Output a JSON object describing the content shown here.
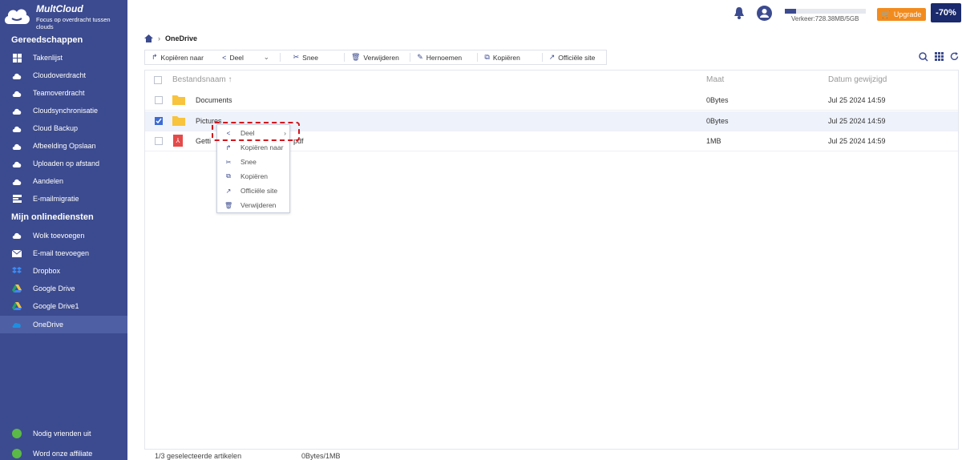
{
  "app": {
    "name": "MultCloud",
    "tagline": "Focus op overdracht tussen clouds"
  },
  "sidebar": {
    "section_tools": "Gereedschappen",
    "tools": [
      {
        "label": "Takenlijst",
        "icon": "grid-icon"
      },
      {
        "label": "Cloudoverdracht",
        "icon": "cloud-transfer-icon"
      },
      {
        "label": "Teamoverdracht",
        "icon": "team-transfer-icon"
      },
      {
        "label": "Cloudsynchronisatie",
        "icon": "cloud-sync-icon"
      },
      {
        "label": "Cloud Backup",
        "icon": "cloud-backup-icon"
      },
      {
        "label": "Afbeelding Opslaan",
        "icon": "image-save-icon"
      },
      {
        "label": "Uploaden op afstand",
        "icon": "remote-upload-icon"
      },
      {
        "label": "Aandelen",
        "icon": "share-cloud-icon"
      },
      {
        "label": "E-mailmigratie",
        "icon": "email-migration-icon"
      }
    ],
    "section_services": "Mijn onlinediensten",
    "services": [
      {
        "label": "Wolk toevoegen",
        "icon": "add-cloud-icon"
      },
      {
        "label": "E-mail toevoegen",
        "icon": "add-email-icon"
      },
      {
        "label": "Dropbox",
        "icon": "dropbox-icon"
      },
      {
        "label": "Google Drive",
        "icon": "google-drive-icon"
      },
      {
        "label": "Google Drive1",
        "icon": "google-drive-icon"
      },
      {
        "label": "OneDrive",
        "icon": "onedrive-icon"
      }
    ],
    "footer": [
      {
        "label": "Nodig vrienden uit",
        "icon": "trophy-icon"
      },
      {
        "label": "Word onze affiliate",
        "icon": "dollar-icon"
      }
    ]
  },
  "header": {
    "traffic": "Verkeer:728.38MB/5GB",
    "traffic_fraction": 0.142,
    "upgrade": "Upgrade",
    "promo": "-70%"
  },
  "breadcrumb": {
    "current": "OneDrive"
  },
  "toolbar": {
    "copy_to": "Kopiëren naar",
    "share": "Deel",
    "cut": "Snee",
    "delete": "Verwijderen",
    "rename": "Hernoemen",
    "copy": "Kopiëren",
    "official_site": "Officiële site"
  },
  "table": {
    "col_name": "Bestandsnaam",
    "col_size": "Maat",
    "col_date": "Datum gewijzigd",
    "rows": [
      {
        "name": "Documents",
        "size": "0Bytes",
        "date": "Jul 25 2024 14:59",
        "type": "folder",
        "checked": false
      },
      {
        "name": "Pictures",
        "size": "0Bytes",
        "date": "Jul 25 2024 14:59",
        "type": "folder",
        "checked": true
      },
      {
        "name": "Getting started with OneDrive.pdf",
        "name_visible_left": "Getti",
        "name_visible_right": "pdf",
        "size": "1MB",
        "date": "Jul 25 2024 14:59",
        "type": "pdf",
        "checked": false
      }
    ]
  },
  "context_menu": {
    "share": "Deel",
    "copy_to": "Kopiëren naar",
    "cut": "Snee",
    "copy": "Kopiëren",
    "official_site": "Officiële site",
    "delete": "Verwijderen"
  },
  "footer": {
    "selected": "1/3 geselecteerde artikelen",
    "size": "0Bytes/1MB"
  },
  "colors": {
    "sidebar": "#3c4b8f",
    "accent": "#3c4b8f",
    "upgrade": "#f28b1e",
    "highlight": "#d4141b"
  }
}
